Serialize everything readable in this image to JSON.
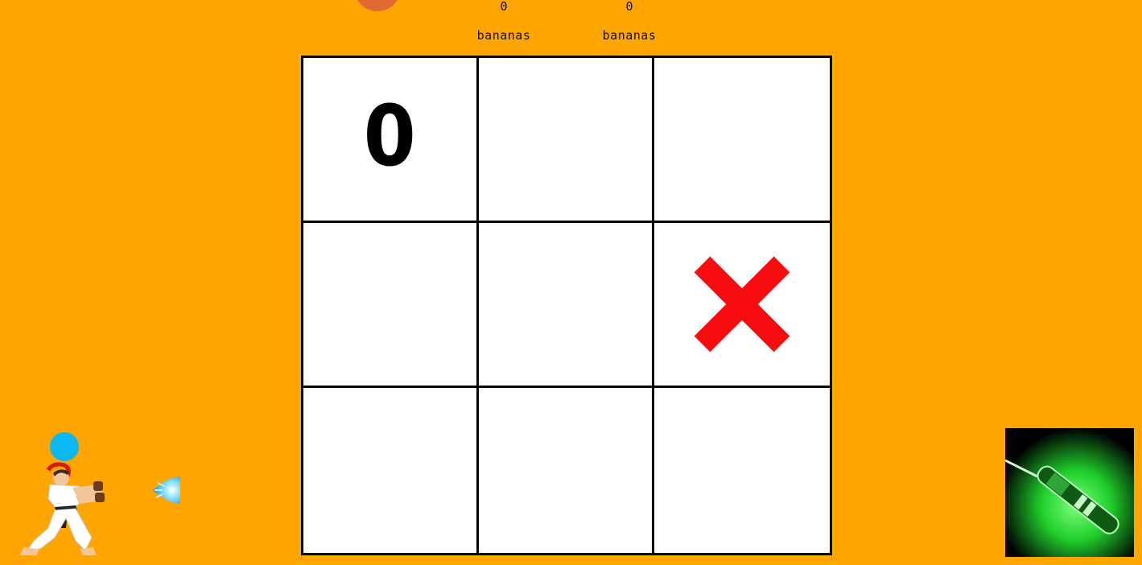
{
  "scores": {
    "player_left": {
      "value": "0",
      "unit": "bananas"
    },
    "player_right": {
      "value": "0",
      "unit": "bananas"
    }
  },
  "board": {
    "cells": [
      [
        "0",
        "",
        ""
      ],
      [
        "",
        "",
        "X"
      ],
      [
        "",
        "",
        ""
      ]
    ]
  },
  "players": {
    "left": {
      "avatar": "fighter-sprite-icon",
      "projectile": "fireball-icon",
      "indicator_color": "#0BB8F2"
    },
    "right": {
      "avatar": "laser-pointer-icon",
      "indicator_color": "#00C73A"
    }
  },
  "colors": {
    "background": "#FFA500",
    "mark_o": "#000000",
    "mark_x": "#F70C10",
    "top_orb": "#E0633A"
  }
}
